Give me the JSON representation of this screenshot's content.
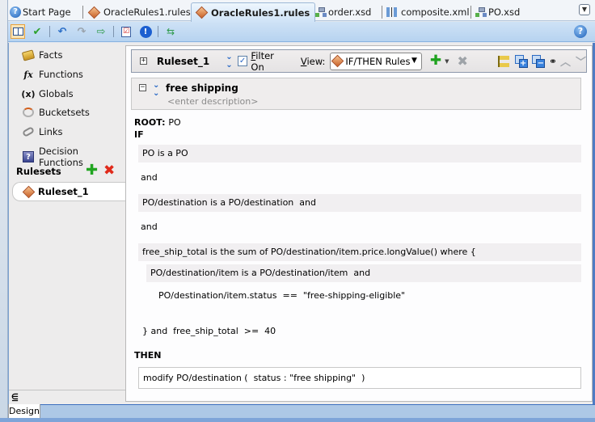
{
  "tabs": [
    {
      "label": "Start Page",
      "icon": "help-icon",
      "active": false
    },
    {
      "label": "OracleRules1.rules",
      "icon": "rules-diamond-icon",
      "active": false
    },
    {
      "label": "OracleRules1.rules",
      "icon": "rules-diamond-icon",
      "active": true
    },
    {
      "label": "order.xsd",
      "icon": "xsd-schema-icon",
      "active": false
    },
    {
      "label": "composite.xml",
      "icon": "composite-icon",
      "active": false
    },
    {
      "label": "PO.xsd",
      "icon": "xsd-schema-icon",
      "active": false
    }
  ],
  "toolbar": {
    "buttons": [
      "dictionary-book-icon",
      "validate-check-icon",
      "undo-icon",
      "redo-icon",
      "import-icon",
      "checklist-icon",
      "info-icon",
      "link-dictionary-icon"
    ],
    "help": "?"
  },
  "sidebar": {
    "items": [
      {
        "label": "Facts",
        "icon": "facts-icon"
      },
      {
        "label": "Functions",
        "icon": "fx-icon",
        "glyph": "fx"
      },
      {
        "label": "Globals",
        "icon": "globals-icon",
        "glyph": "(x)"
      },
      {
        "label": "Bucketsets",
        "icon": "bucketsets-icon"
      },
      {
        "label": "Links",
        "icon": "links-icon"
      },
      {
        "label": "Decision Functions",
        "icon": "decision-functions-icon",
        "glyph": "?"
      }
    ],
    "rulesets_label": "Rulesets",
    "rulesets": [
      {
        "label": "Ruleset_1"
      }
    ]
  },
  "ruleset_header": {
    "title": "Ruleset_1",
    "filter_label_first": "F",
    "filter_label_rest": "ilter On",
    "filter_checked": true,
    "view_label_first": "V",
    "view_label_rest": "iew:",
    "view_selected": "IF/THEN Rules"
  },
  "rule": {
    "name": "free shipping",
    "description_placeholder": "<enter description>",
    "root_label": "ROOT:",
    "root_value": "PO",
    "if_label": "IF",
    "then_label": "THEN",
    "conditions": {
      "c1": "PO is a PO",
      "and1": "and",
      "c2": "PO/destination is a PO/destination  and",
      "and2": "and",
      "c3": "free_ship_total is the sum of PO/destination/item.price.longValue() where {",
      "c3a": "PO/destination/item is a PO/destination/item  and",
      "c3b": "PO/destination/item.status  ==  \"free-shipping-eligible\"",
      "c3end": "} and  free_ship_total  >=  40"
    },
    "action": "modify PO/destination (  status : \"free shipping\"  )"
  },
  "bottom": {
    "design_tab": "Design",
    "collapse": "⋸"
  }
}
